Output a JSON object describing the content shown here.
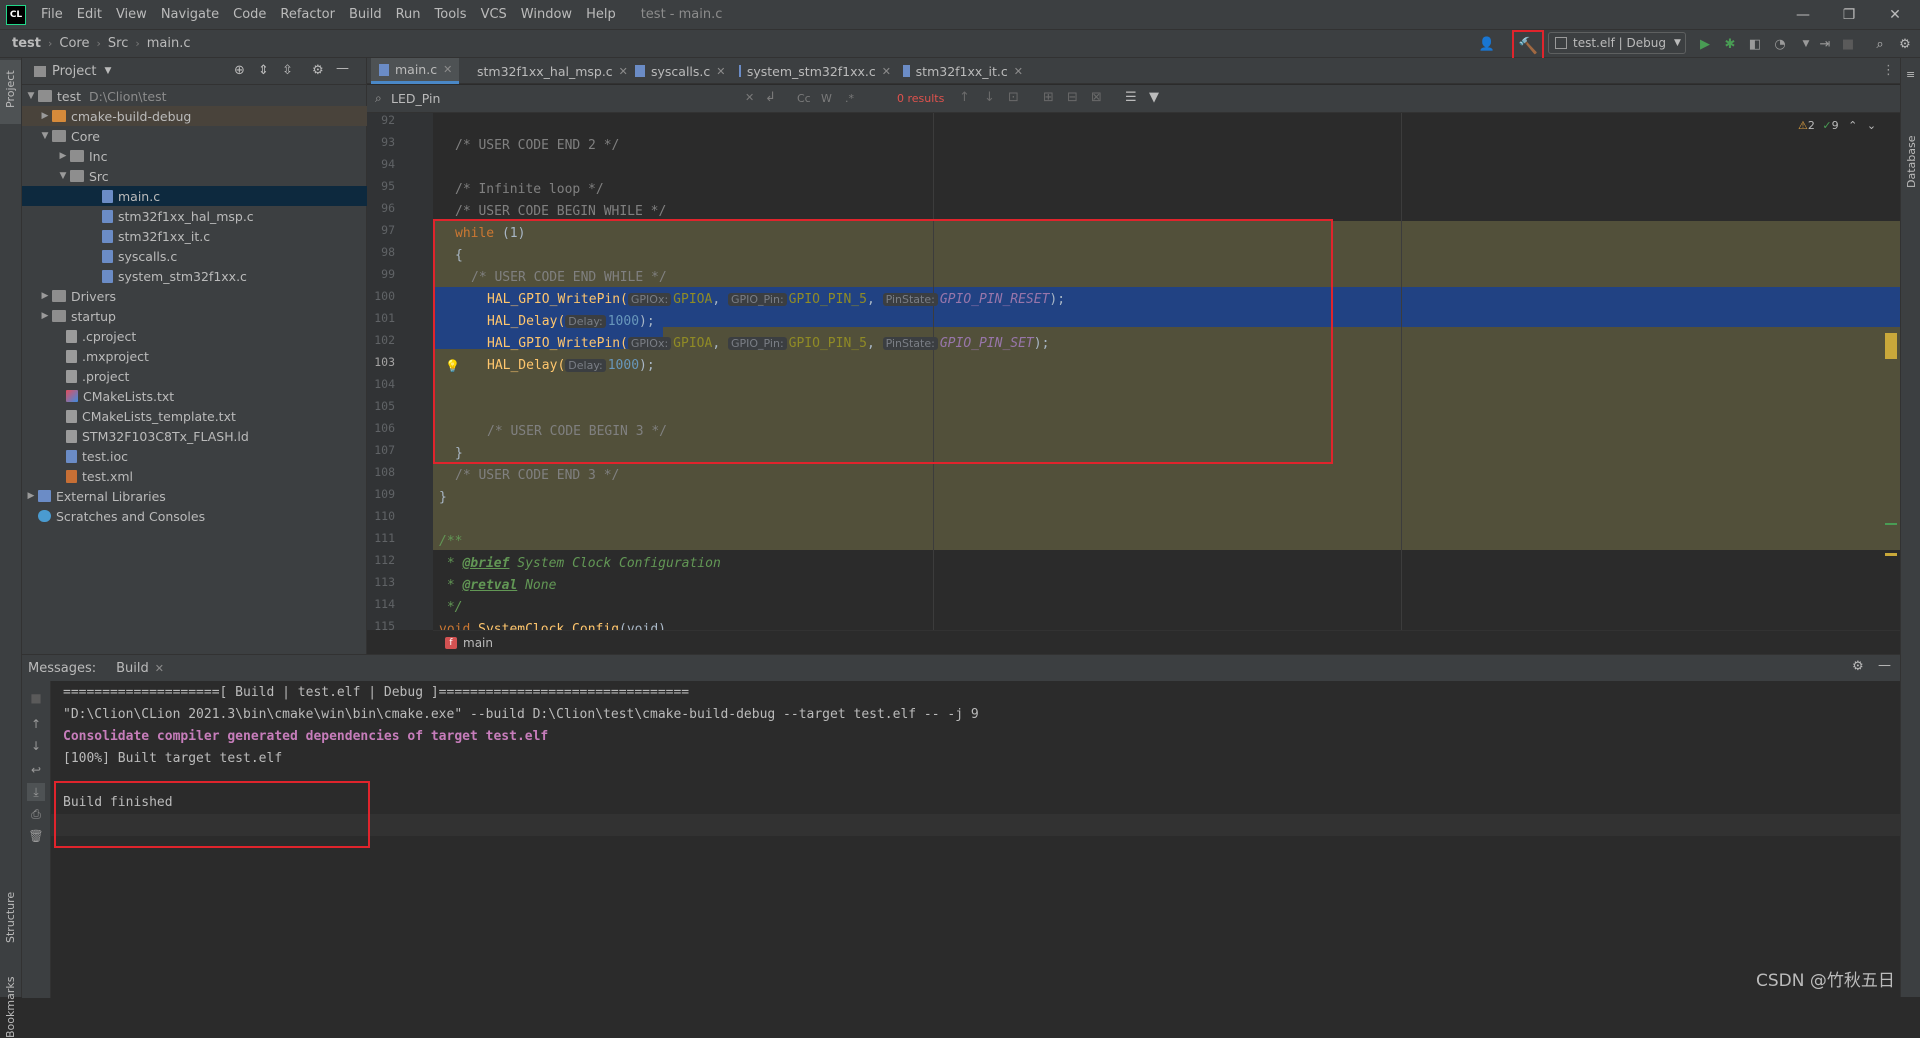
{
  "window": {
    "title": "test - main.c",
    "app_icon": "CL",
    "menu": [
      "File",
      "Edit",
      "View",
      "Navigate",
      "Code",
      "Refactor",
      "Build",
      "Run",
      "Tools",
      "VCS",
      "Window",
      "Help"
    ],
    "controls": {
      "minimize": "—",
      "restore": "❐",
      "close": "✕"
    }
  },
  "breadcrumb": [
    "test",
    "Core",
    "Src",
    "main.c"
  ],
  "toolbar": {
    "run_config": "test.elf | Debug",
    "accent": "#e0242c"
  },
  "project": {
    "header": "Project",
    "root_label": "test",
    "root_path": "D:\\Clion\\test",
    "items": [
      {
        "label": "cmake-build-debug"
      },
      {
        "label": "Core"
      },
      {
        "label": "Inc"
      },
      {
        "label": "Src"
      },
      {
        "label": "main.c"
      },
      {
        "label": "stm32f1xx_hal_msp.c"
      },
      {
        "label": "stm32f1xx_it.c"
      },
      {
        "label": "syscalls.c"
      },
      {
        "label": "system_stm32f1xx.c"
      },
      {
        "label": "Drivers"
      },
      {
        "label": "startup"
      },
      {
        "label": ".cproject"
      },
      {
        "label": ".mxproject"
      },
      {
        "label": ".project"
      },
      {
        "label": "CMakeLists.txt"
      },
      {
        "label": "CMakeLists_template.txt"
      },
      {
        "label": "STM32F103C8Tx_FLASH.ld"
      },
      {
        "label": "test.ioc"
      },
      {
        "label": "test.xml"
      },
      {
        "label": "External Libraries"
      },
      {
        "label": "Scratches and Consoles"
      }
    ]
  },
  "tabs": [
    "main.c",
    "stm32f1xx_hal_msp.c",
    "syscalls.c",
    "system_stm32f1xx.c",
    "stm32f1xx_it.c"
  ],
  "search": {
    "query": "LED_Pin",
    "case_toggle": "Cc",
    "word_toggle": "W",
    "regex_toggle": ".*",
    "results": "0 results"
  },
  "inspections": {
    "warnings": "2",
    "ok": "9"
  },
  "side_labels": {
    "project": "Project",
    "structure": "Structure",
    "bookmarks": "Bookmarks",
    "database": "Database"
  },
  "editor": {
    "line_numbers": [
      "92",
      "93",
      "94",
      "95",
      "96",
      "97",
      "98",
      "99",
      "100",
      "101",
      "102",
      "103",
      "104",
      "105",
      "106",
      "107",
      "108",
      "109",
      "110",
      "111",
      "112",
      "113",
      "114",
      "115"
    ],
    "lines": {
      "l93": "/* USER CODE END 2 */",
      "l95": "/* Infinite loop */",
      "l96": "/* USER CODE BEGIN WHILE */",
      "l97_kw": "while",
      "l97_rest": " (1)",
      "l98": "{",
      "l99": "/* USER CODE END WHILE */",
      "fn_write": "HAL_GPIO_WritePin(",
      "fn_delay": "HAL_Delay(",
      "hint_gpiox": "GPIOx:",
      "hint_pin": "GPIO_Pin:",
      "hint_state": "PinState:",
      "hint_delay": "Delay:",
      "gpioa": "GPIOA",
      "pin5": "GPIO_PIN_5",
      "reset": "GPIO_PIN_RESET",
      "set": "GPIO_PIN_SET",
      "delay_val": "1000",
      "close_paren": ");",
      "comma": ", ",
      "l106": "/* USER CODE BEGIN 3 */",
      "l107": "}",
      "l108": "/* USER CODE END 3 */",
      "l109": "}",
      "l111": "/**",
      "l112_pre": " * ",
      "l112_tag": "@brief",
      "l112_text": " System Clock Configuration",
      "l113_pre": " * ",
      "l113_tag": "@retval",
      "l113_text": " None",
      "l114": " */",
      "l115_kw": "void",
      "l115_fn": " SystemClock_Config",
      "l115_rest": "(void)"
    },
    "footer_breadcrumb": "main"
  },
  "messages": {
    "label": "Messages:",
    "tab": "Build",
    "output": [
      "====================[ Build | test.elf | Debug ]================================",
      "\"D:\\Clion\\CLion 2021.3\\bin\\cmake\\win\\bin\\cmake.exe\" --build D:\\Clion\\test\\cmake-build-debug --target test.elf -- -j 9",
      "Consolidate compiler generated dependencies of target test.elf",
      "[100%] Built target test.elf",
      "Build finished"
    ]
  },
  "watermark": "CSDN @竹秋五日"
}
